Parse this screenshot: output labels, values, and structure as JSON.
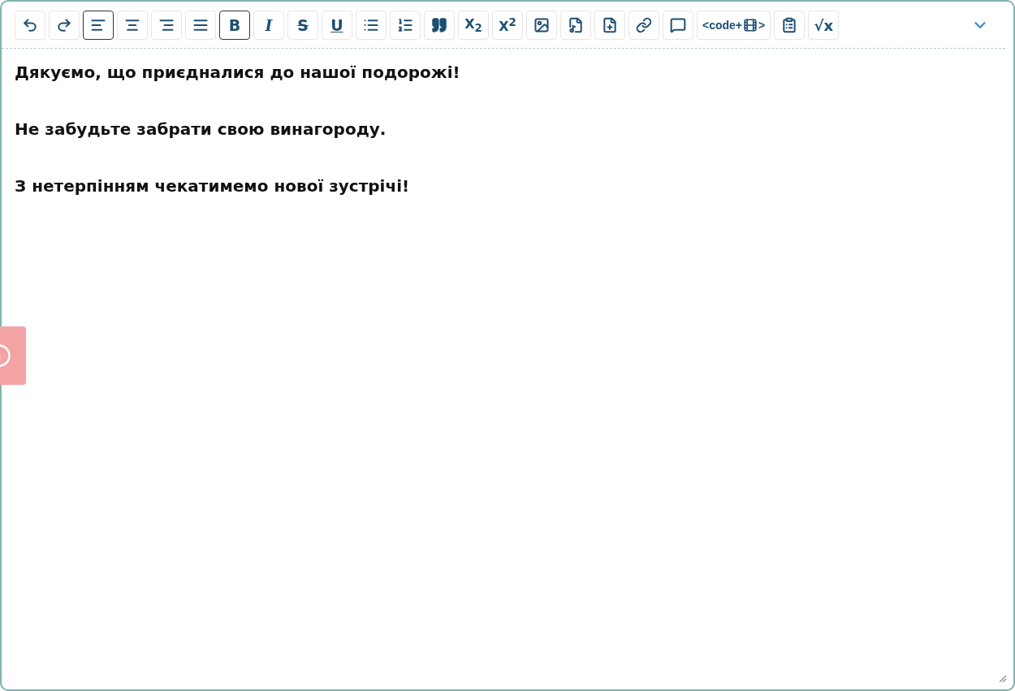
{
  "toolbar": [
    {
      "kind": "undo",
      "selected": false
    },
    {
      "kind": "redo",
      "selected": false
    },
    {
      "kind": "align-left",
      "selected": true
    },
    {
      "kind": "align-center",
      "selected": false
    },
    {
      "kind": "align-right",
      "selected": false
    },
    {
      "kind": "align-justify",
      "selected": false
    },
    {
      "kind": "bold",
      "label": "B",
      "selected": true
    },
    {
      "kind": "italic",
      "label": "I",
      "selected": false
    },
    {
      "kind": "strike",
      "label": "S",
      "selected": false
    },
    {
      "kind": "underline",
      "label": "U",
      "selected": false
    },
    {
      "kind": "bullet-list",
      "selected": false
    },
    {
      "kind": "number-list",
      "selected": false
    },
    {
      "kind": "quote",
      "selected": false
    },
    {
      "kind": "subscript",
      "label": "X$_{2}$",
      "selected": false
    },
    {
      "kind": "superscript",
      "label": "X$^{2}$",
      "selected": false
    },
    {
      "kind": "image",
      "selected": false
    },
    {
      "kind": "audio",
      "selected": false
    },
    {
      "kind": "file",
      "selected": false
    },
    {
      "kind": "link",
      "selected": false
    },
    {
      "kind": "comment",
      "selected": false
    },
    {
      "kind": "embed",
      "label": "<code+",
      "label_end": ">",
      "selected": false
    },
    {
      "kind": "clipboard",
      "selected": false
    },
    {
      "kind": "math",
      "label": "√x",
      "selected": false
    }
  ],
  "content": [
    "Дякуємо, що приєдналися до нашої подорожі!",
    "Не забудьте забрати свою винагороду.",
    "З нетерпінням чекатимемо нової зустрічі!"
  ]
}
